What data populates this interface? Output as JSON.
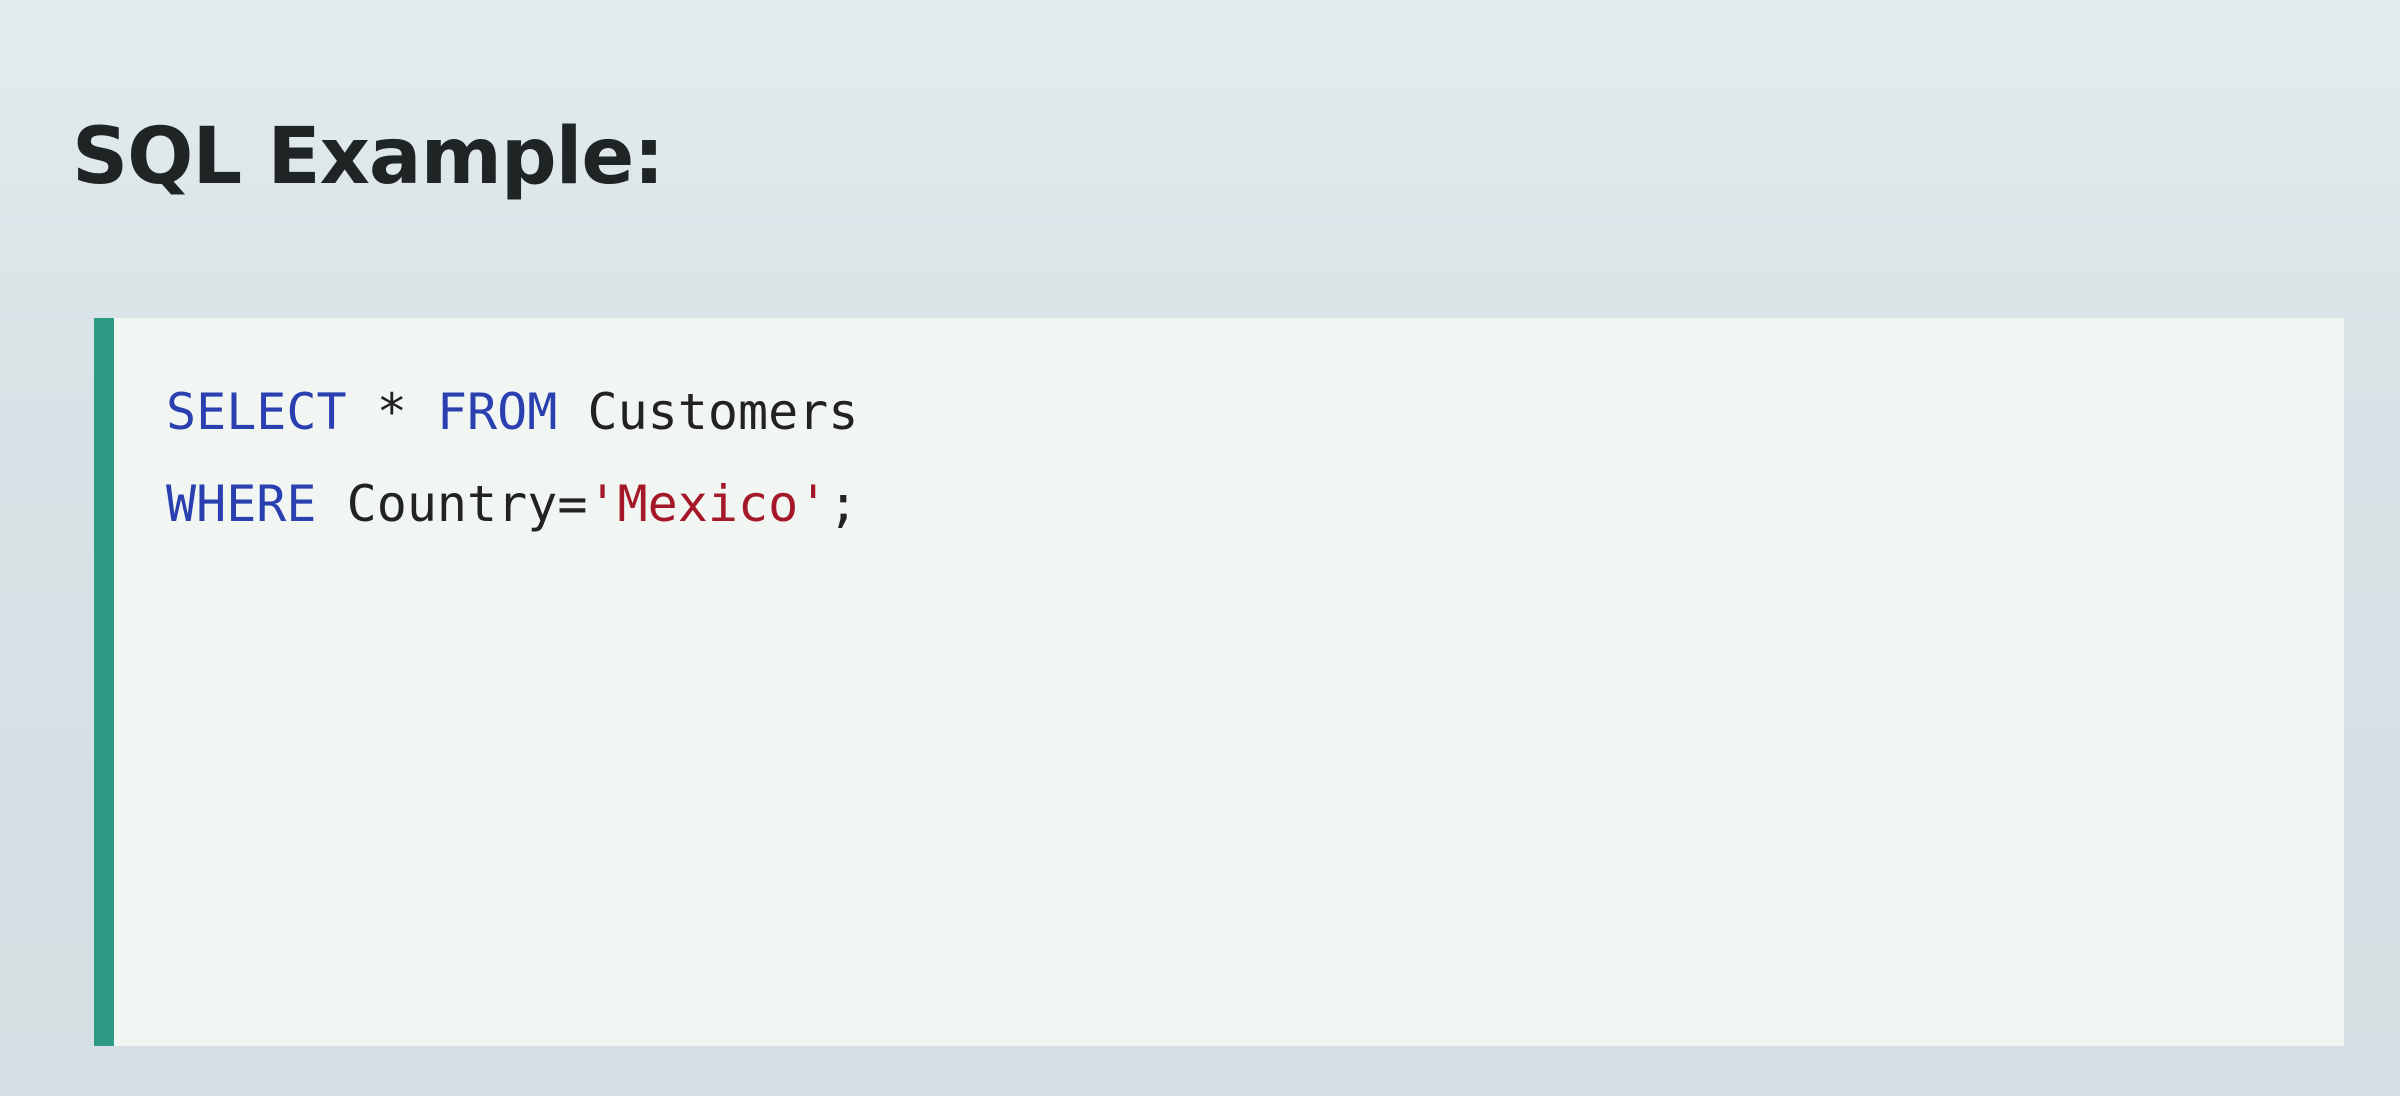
{
  "heading": "SQL Example:",
  "code": {
    "line1": {
      "kw1": "SELECT",
      "sp1": " * ",
      "kw2": "FROM",
      "rest": " Customers"
    },
    "line2": {
      "kw1": "WHERE",
      "rest": " Country=",
      "string": "'Mexico'",
      "end": ";"
    }
  },
  "colors": {
    "keyword": "#2a3fb0",
    "string": "#a5182a",
    "accent_border": "#2f9a83",
    "code_background": "#f2f6f3"
  }
}
